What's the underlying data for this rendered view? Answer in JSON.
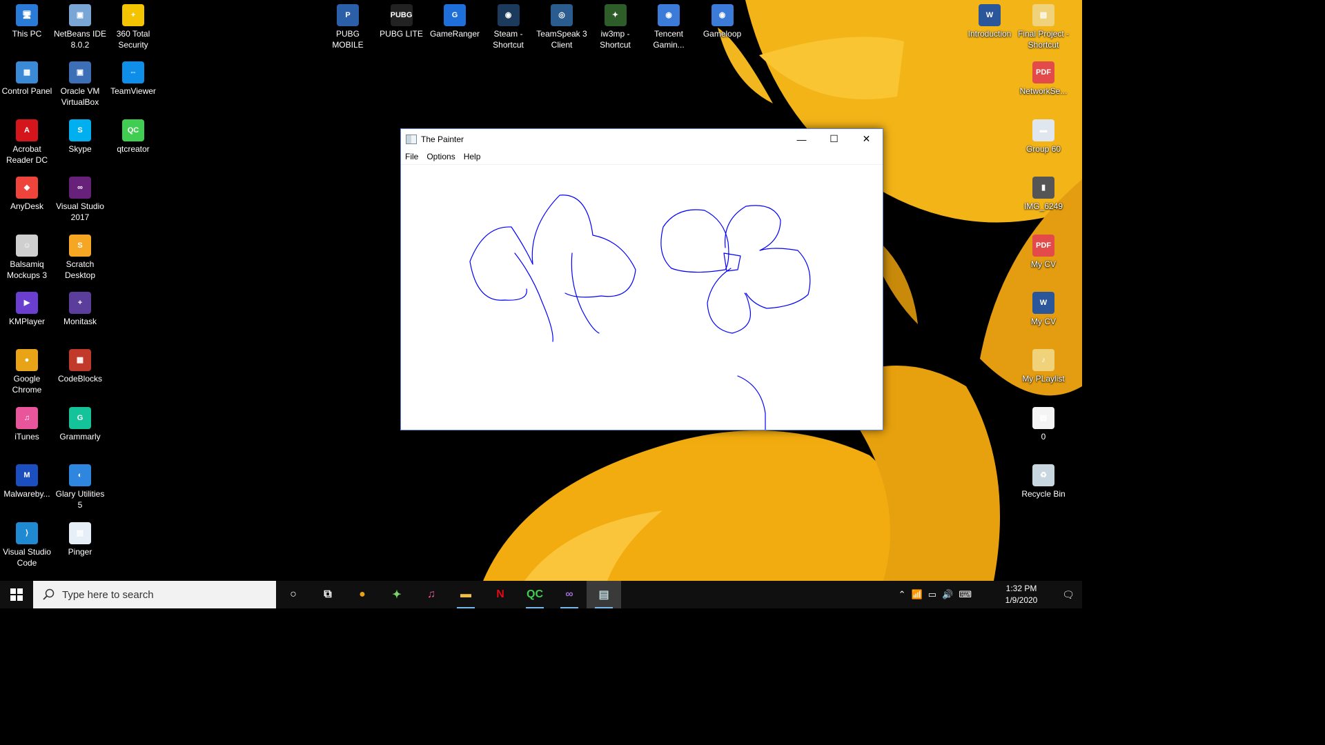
{
  "desktop": {
    "left_col1": [
      {
        "label": "This PC",
        "color": "#2a7bd8",
        "glyph": "🖥",
        "icon": "computer-icon"
      },
      {
        "label": "Control Panel",
        "color": "#3a8ad8",
        "glyph": "▦",
        "icon": "control-panel-icon"
      },
      {
        "label": "Acrobat Reader DC",
        "color": "#d4161c",
        "glyph": "A",
        "icon": "acrobat-icon"
      },
      {
        "label": "AnyDesk",
        "color": "#ef443b",
        "glyph": "◆",
        "icon": "anydesk-icon"
      },
      {
        "label": "Balsamiq Mockups 3",
        "color": "#cfcfcf",
        "glyph": "☺",
        "icon": "balsamiq-icon"
      },
      {
        "label": "KMPlayer",
        "color": "#6a3fd0",
        "glyph": "▶",
        "icon": "kmplayer-icon"
      },
      {
        "label": "Google Chrome",
        "color": "#e8a317",
        "glyph": "●",
        "icon": "chrome-icon"
      },
      {
        "label": "iTunes",
        "color": "#e9559b",
        "glyph": "♫",
        "icon": "itunes-icon"
      },
      {
        "label": "Malwareby...",
        "color": "#1b4fbf",
        "glyph": "M",
        "icon": "malwarebytes-icon"
      },
      {
        "label": "Visual Studio Code",
        "color": "#1f8ad2",
        "glyph": "⟩",
        "icon": "vscode-icon"
      }
    ],
    "left_col2": [
      {
        "label": "NetBeans IDE 8.0.2",
        "color": "#7aa6d6",
        "glyph": "▣",
        "icon": "netbeans-icon"
      },
      {
        "label": "Oracle VM VirtualBox",
        "color": "#3c6fb6",
        "glyph": "▣",
        "icon": "virtualbox-icon"
      },
      {
        "label": "Skype",
        "color": "#00aff0",
        "glyph": "S",
        "icon": "skype-icon"
      },
      {
        "label": "Visual Studio 2017",
        "color": "#68217a",
        "glyph": "∞",
        "icon": "visual-studio-icon"
      },
      {
        "label": "Scratch Desktop",
        "color": "#f5a623",
        "glyph": "S",
        "icon": "scratch-icon"
      },
      {
        "label": "Monitask",
        "color": "#5b3d9c",
        "glyph": "+",
        "icon": "monitask-icon"
      },
      {
        "label": "CodeBlocks",
        "color": "#c0392b",
        "glyph": "▦",
        "icon": "codeblocks-icon"
      },
      {
        "label": "Grammarly",
        "color": "#15c39a",
        "glyph": "G",
        "icon": "grammarly-icon"
      },
      {
        "label": "Glary Utilities 5",
        "color": "#2e86de",
        "glyph": "◐",
        "icon": "glary-icon"
      },
      {
        "label": "Pinger",
        "color": "#e6eef8",
        "glyph": "▤",
        "icon": "pinger-icon"
      }
    ],
    "left_col3": [
      {
        "label": "360 Total Security",
        "color": "#f5c400",
        "glyph": "+",
        "icon": "360-security-icon"
      },
      {
        "label": "TeamViewer",
        "color": "#0e8ee9",
        "glyph": "⇔",
        "icon": "teamviewer-icon"
      },
      {
        "label": "qtcreator",
        "color": "#41cd52",
        "glyph": "QC",
        "icon": "qtcreator-icon"
      }
    ],
    "top_row": [
      {
        "label": "PUBG MOBILE",
        "color": "#2b5fa8",
        "glyph": "P",
        "icon": "pubg-mobile-icon"
      },
      {
        "label": "PUBG LITE",
        "color": "#222222",
        "glyph": "PUBG",
        "icon": "pubg-lite-icon"
      },
      {
        "label": "GameRanger",
        "color": "#1e6fd9",
        "glyph": "G",
        "icon": "gameranger-icon"
      },
      {
        "label": "Steam - Shortcut",
        "color": "#1b3a5c",
        "glyph": "◉",
        "icon": "steam-icon"
      },
      {
        "label": "TeamSpeak 3 Client",
        "color": "#2b5c8f",
        "glyph": "◎",
        "icon": "teamspeak-icon"
      },
      {
        "label": "iw3mp - Shortcut",
        "color": "#2f5d2a",
        "glyph": "✦",
        "icon": "iw3mp-icon"
      },
      {
        "label": "Tencent Gamin...",
        "color": "#3c7bd8",
        "glyph": "◉",
        "icon": "tencent-icon"
      },
      {
        "label": "Gameloop",
        "color": "#3c7bd8",
        "glyph": "◉",
        "icon": "gameloop-icon"
      }
    ],
    "right_col1": [
      {
        "label": "Introduction",
        "color": "#2b579a",
        "glyph": "W",
        "icon": "word-doc-icon"
      }
    ],
    "right_col2": [
      {
        "label": "Final Project - Shortcut",
        "color": "#f0d27a",
        "glyph": "▤",
        "icon": "folder-shortcut-icon"
      },
      {
        "label": "NetworkSe...",
        "color": "#e34a4a",
        "glyph": "PDF",
        "icon": "pdf-icon"
      },
      {
        "label": "Group 60",
        "color": "#dfe6ee",
        "glyph": "▬",
        "icon": "image-file-icon"
      },
      {
        "label": "IMG_6249",
        "color": "#555555",
        "glyph": "▮",
        "icon": "photo-icon"
      },
      {
        "label": "My CV",
        "color": "#e34a4a",
        "glyph": "PDF",
        "icon": "pdf-icon"
      },
      {
        "label": "My CV",
        "color": "#2b579a",
        "glyph": "W",
        "icon": "word-doc-icon"
      },
      {
        "label": "My PLaylist",
        "color": "#f0d27a",
        "glyph": "♪",
        "icon": "playlist-icon"
      },
      {
        "label": "0",
        "color": "#f4f4f4",
        "glyph": "▤",
        "icon": "text-file-icon"
      },
      {
        "label": "Recycle Bin",
        "color": "#c8d6e0",
        "glyph": "♻",
        "icon": "recycle-bin-icon"
      }
    ]
  },
  "painter": {
    "title": "The Painter",
    "menu": [
      "File",
      "Options",
      "Help"
    ],
    "minimize": "—",
    "maximize": "☐",
    "close": "✕",
    "stroke_color": "#0000ff"
  },
  "taskbar": {
    "search_placeholder": "Type here to search",
    "apps": [
      {
        "name": "cortana-icon",
        "glyph": "○",
        "color": "#ffffff",
        "running": false,
        "active": false
      },
      {
        "name": "task-view-icon",
        "glyph": "⧉",
        "color": "#ffffff",
        "running": false,
        "active": false
      },
      {
        "name": "chrome-icon",
        "glyph": "●",
        "color": "#e8a317",
        "running": false,
        "active": false
      },
      {
        "name": "iw3mp-icon",
        "glyph": "✦",
        "color": "#7bd46a",
        "running": false,
        "active": false
      },
      {
        "name": "itunes-icon",
        "glyph": "♫",
        "color": "#e9559b",
        "running": false,
        "active": false
      },
      {
        "name": "file-explorer-icon",
        "glyph": "▬",
        "color": "#f0c040",
        "running": true,
        "active": false
      },
      {
        "name": "netflix-icon",
        "glyph": "N",
        "color": "#e50914",
        "running": false,
        "active": false
      },
      {
        "name": "qtcreator-icon",
        "glyph": "QC",
        "color": "#41cd52",
        "running": true,
        "active": false
      },
      {
        "name": "visual-studio-icon",
        "glyph": "∞",
        "color": "#9b6cd6",
        "running": true,
        "active": false
      },
      {
        "name": "painter-icon",
        "glyph": "▤",
        "color": "#b9d3d8",
        "running": true,
        "active": true
      }
    ],
    "tray": [
      "⌃",
      "📶",
      "▭",
      "🔊",
      "⌨"
    ],
    "time": "1:32 PM",
    "date": "1/9/2020",
    "notifications": "🗨"
  }
}
